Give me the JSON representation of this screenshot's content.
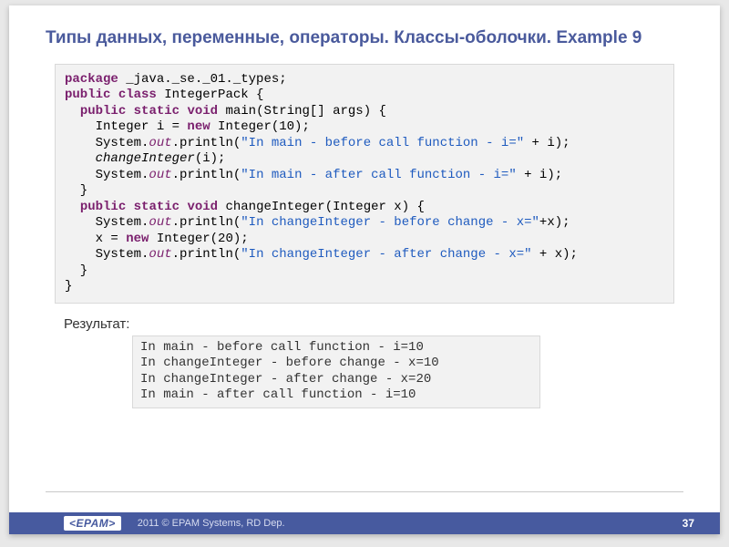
{
  "title": "Типы данных, переменные, операторы. Классы-оболочки. Example 9",
  "code": {
    "package_kw": "package",
    "package_name": " _java._se._01._types;",
    "public_kw": "public",
    "class_kw": "class",
    "class_name": " IntegerPack {",
    "static_kw": "static",
    "void_kw": "void",
    "main_sig": " main(String[] args) {",
    "int_decl_a": "    Integer i = ",
    "new_kw": "new",
    "int_decl_b": " Integer(10);",
    "sys": "    System.",
    "out": "out",
    "println": ".println(",
    "str_main_before": "\"In main - before call function - i=\"",
    "plus_i": " + i);",
    "call_change": "changeInteger",
    "call_change_arg": "(i);",
    "str_main_after": "\"In main - after call function - i=\"",
    "close_brace": "  }",
    "change_sig": " changeInteger(Integer x) {",
    "str_ci_before": "\"In changeInteger - before change - x=\"",
    "plus_x_a": "+x);",
    "x_assign_a": "    x = ",
    "x_assign_b": " Integer(20);",
    "str_ci_after": "\"In changeInteger - after change - x=\"",
    "plus_x_b": " + x);",
    "close_brace2": "  }",
    "final_brace": "}"
  },
  "result_label": "Результат:",
  "result_lines": {
    "l1": "In main - before call function - i=10",
    "l2": "In changeInteger - before change - x=10",
    "l3": "In changeInteger - after change - x=20",
    "l4": "In main - after call function - i=10"
  },
  "footer": {
    "logo": "<EPAM>",
    "copyright": "2011 © EPAM Systems, RD Dep.",
    "page": "37"
  }
}
